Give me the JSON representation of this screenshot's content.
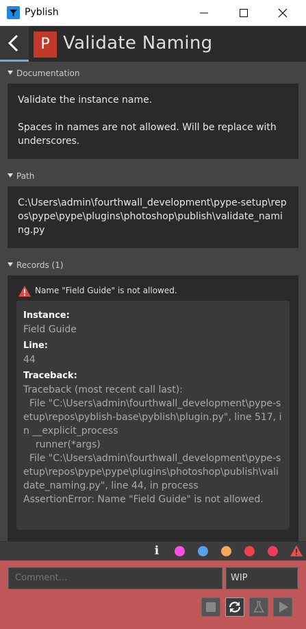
{
  "window": {
    "title": "Pyblish"
  },
  "header": {
    "badge": "P",
    "title": "Validate Naming"
  },
  "sections": {
    "documentation": {
      "label": "Documentation",
      "text": "Validate the instance name.\n\nSpaces in names are not allowed. Will be replace with underscores."
    },
    "path": {
      "label": "Path",
      "text": "C:\\Users\\admin\\fourthwall_development\\pype-setup\\repos\\pype\\pype\\plugins\\photoshop\\publish\\validate_naming.py"
    },
    "records": {
      "label": "Records (1)",
      "warning": "Name \"Field Guide\" is not allowed.",
      "instance_label": "Instance:",
      "instance_value": "Field Guide",
      "line_label": "Line:",
      "line_value": "44",
      "traceback_label": "Traceback:",
      "traceback": "Traceback (most recent call last):\n  File \"C:\\Users\\admin\\fourthwall_development\\pype-setup\\repos\\pyblish-base\\pyblish\\plugin.py\", line 517, in __explicit_process\n    runner(*args)\n  File \"C:\\Users\\admin\\fourthwall_development\\pype-setup\\repos\\pype\\pype\\plugins\\photoshop\\publish\\validate_naming.py\", line 44, in process\nAssertionError: Name \"Field Guide\" is not allowed."
    }
  },
  "statusbar": {
    "icons": [
      "info-icon",
      "dot-magenta",
      "dot-blue",
      "dot-orange",
      "dot-red",
      "dot-pink-red",
      "warning-icon"
    ],
    "colors": {
      "magenta": "#ff4fe0",
      "blue": "#5a9ef0",
      "orange": "#f5a85a",
      "red": "#f2404a",
      "pink_red": "#f03c5c",
      "warning": "#f24b4b"
    }
  },
  "bottom": {
    "comment_placeholder": "Comment...",
    "intent_value": "WIP",
    "buttons": [
      "stop-icon",
      "reset-icon",
      "validate-icon",
      "play-icon"
    ]
  },
  "colors": {
    "accent": "#5fb5e8",
    "badge": "#c0392b",
    "footer": "#c0585a"
  }
}
